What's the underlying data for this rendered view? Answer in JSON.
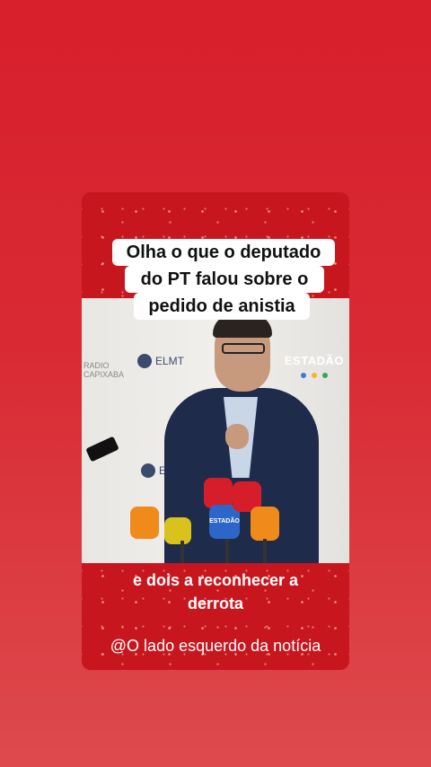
{
  "caption": {
    "line1": "Olha o que o deputado",
    "line2": "do PT falou sobre o",
    "line3": "pedido de anistia"
  },
  "subtitle": {
    "line1": "e dois a reconhecer a",
    "line2": "derrota"
  },
  "handle": "@O lado esquerdo da notícia",
  "photo": {
    "elmt_logo": "ELMT",
    "elmt_logo_2": "ELMT",
    "watermark": "ESTADÃO",
    "mic_label": "ESTADÃO"
  },
  "colors": {
    "background": "#d81f2c",
    "card": "#c8161f",
    "caption_box": "#ffffff",
    "dot_1": "#3b7bd8",
    "dot_2": "#f2b233",
    "dot_3": "#33a852"
  }
}
